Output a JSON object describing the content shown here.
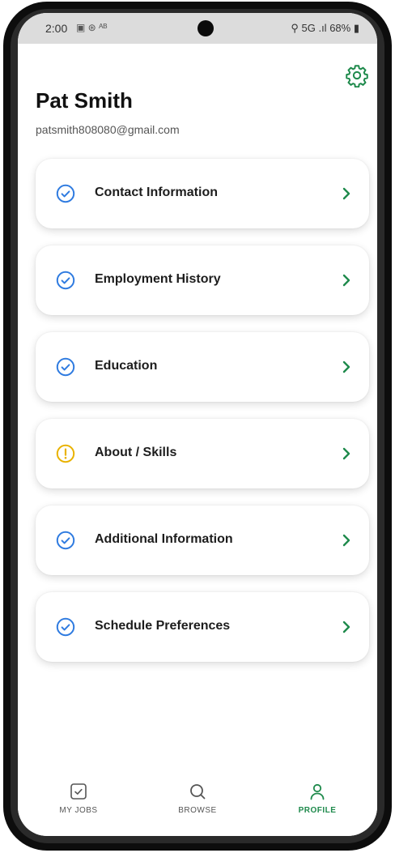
{
  "colors": {
    "accent": "#1f8a4c",
    "check": "#2f7be0",
    "warning": "#e9b200"
  },
  "status_bar": {
    "time": "2:00",
    "left_icons": "▣ ⊛ ᴬᴮ",
    "network": "5G",
    "battery": "68%"
  },
  "header": {
    "settings_icon": "gear-icon",
    "name": "Pat Smith",
    "email": "patsmith808080@gmail.com"
  },
  "sections": [
    {
      "label": "Contact Information",
      "status": "complete"
    },
    {
      "label": "Employment History",
      "status": "complete"
    },
    {
      "label": "Education",
      "status": "complete"
    },
    {
      "label": "About / Skills",
      "status": "warning"
    },
    {
      "label": "Additional Information",
      "status": "complete"
    },
    {
      "label": "Schedule Preferences",
      "status": "complete"
    }
  ],
  "tabs": [
    {
      "label": "MY JOBS",
      "icon": "checkbox-icon",
      "active": false
    },
    {
      "label": "BROWSE",
      "icon": "search-icon",
      "active": false
    },
    {
      "label": "PROFILE",
      "icon": "person-icon",
      "active": true
    }
  ]
}
